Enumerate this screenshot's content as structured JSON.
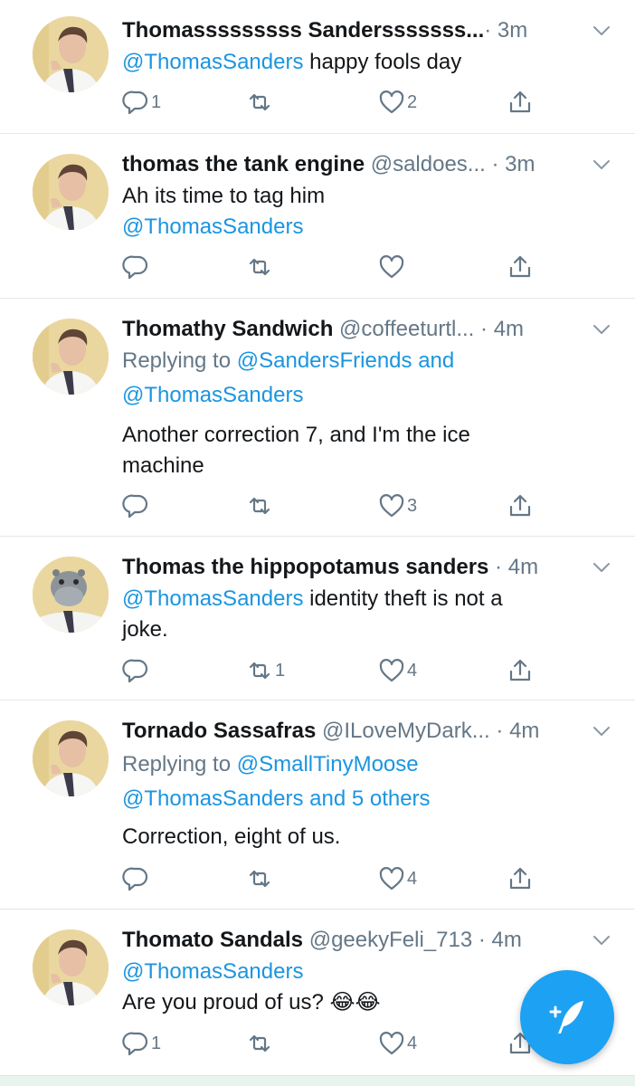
{
  "tweets": [
    {
      "name": "Thomasssssssss Sandersssssss...",
      "handle": "",
      "time": "· 3m",
      "lines": [
        [
          {
            "t": "@ThomasSanders",
            "m": true
          },
          {
            "t": " happy fools day",
            "m": false
          }
        ]
      ],
      "reply_count": "1",
      "retweet_count": "",
      "like_count": "2",
      "avatar": "person"
    },
    {
      "name": "thomas the tank engine",
      "handle": " @saldoes...",
      "time": " · 3m",
      "lines": [
        [
          {
            "t": "Ah its time to tag him",
            "m": false
          }
        ],
        [
          {
            "t": "@ThomasSanders",
            "m": true
          }
        ]
      ],
      "reply_count": "",
      "retweet_count": "",
      "like_count": "",
      "avatar": "person"
    },
    {
      "name": "Thomathy Sandwich",
      "handle": " @coffeeturtl...",
      "time": " · 4m",
      "lines": [
        [
          {
            "t": "Replying to ",
            "m": false,
            "g": true
          },
          {
            "t": "@SandersFriends",
            "m": true
          },
          {
            "t": " and",
            "m": true
          }
        ],
        [
          {
            "t": "@ThomasSanders",
            "m": true
          }
        ],
        [
          {
            "t": "Another correction 7, and I'm the ice",
            "m": false
          }
        ],
        [
          {
            "t": "machine",
            "m": false
          }
        ]
      ],
      "reply_count": "",
      "retweet_count": "",
      "like_count": "3",
      "avatar": "person"
    },
    {
      "name": "Thomas the hippopotamus sanders",
      "handle": "",
      "time": " · 4m",
      "lines": [
        [
          {
            "t": "@ThomasSanders",
            "m": true
          },
          {
            "t": " identity theft is not a",
            "m": false
          }
        ],
        [
          {
            "t": "joke.",
            "m": false
          }
        ]
      ],
      "reply_count": "",
      "retweet_count": "1",
      "like_count": "4",
      "avatar": "hippo"
    },
    {
      "name": "Tornado Sassafras",
      "handle": " @ILoveMyDark...",
      "time": " · 4m",
      "lines": [
        [
          {
            "t": "Replying to ",
            "m": false,
            "g": true
          },
          {
            "t": "@SmallTinyMoose",
            "m": true
          }
        ],
        [
          {
            "t": "@ThomasSanders and 5 others",
            "m": true
          }
        ],
        [
          {
            "t": "Correction, eight of us.",
            "m": false
          }
        ]
      ],
      "reply_count": "",
      "retweet_count": "",
      "like_count": "4",
      "avatar": "person"
    },
    {
      "name": "Thomato Sandals",
      "handle": " @geekyFeli_713",
      "time": " · 4m",
      "lines": [
        [
          {
            "t": "@ThomasSanders",
            "m": true
          }
        ],
        [
          {
            "t": "Are you proud of us? 😂😂",
            "m": false
          }
        ]
      ],
      "reply_count": "1",
      "retweet_count": "",
      "like_count": "4",
      "avatar": "person"
    }
  ],
  "colors": {
    "link": "#1b95e0",
    "secondary": "#657786",
    "accent": "#1da1f2"
  },
  "icons": {
    "reply": "reply-icon",
    "retweet": "retweet-icon",
    "like": "heart-icon",
    "share": "share-icon",
    "chevron": "chevron-down-icon",
    "compose": "compose-tweet-icon"
  }
}
